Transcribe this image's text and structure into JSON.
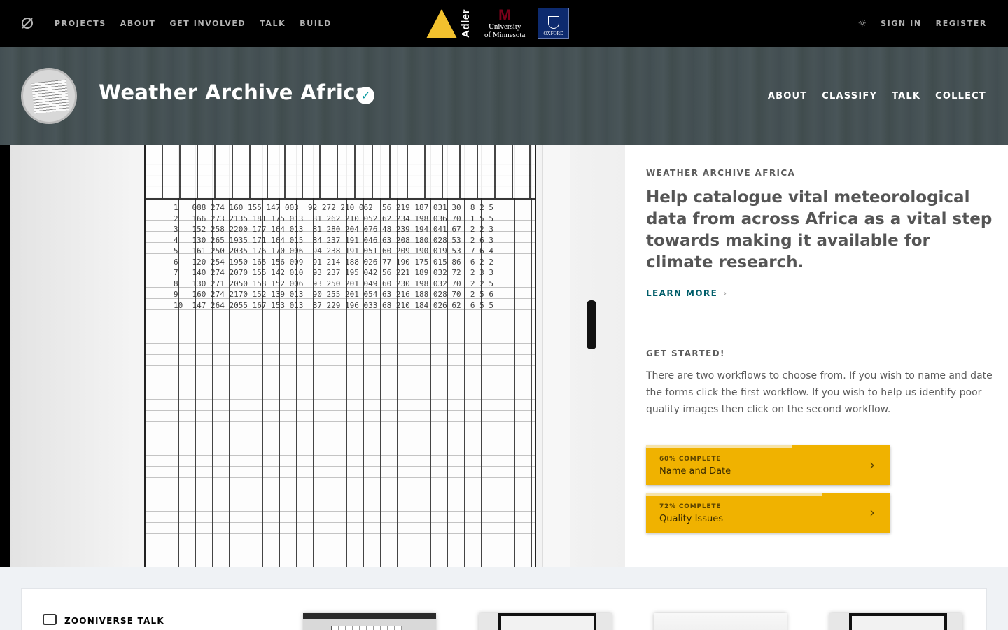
{
  "topnav": {
    "links": [
      "PROJECTS",
      "ABOUT",
      "GET INVOLVED",
      "TALK",
      "BUILD"
    ],
    "sign_in": "SIGN IN",
    "register": "REGISTER",
    "partners": {
      "adler": "Adler",
      "umn_line1": "University",
      "umn_line2": "of Minnesota",
      "oxford": "OXFORD"
    }
  },
  "project": {
    "title": "Weather Archive Africa",
    "nav": [
      "ABOUT",
      "CLASSIFY",
      "TALK",
      "COLLECT"
    ]
  },
  "hero": {
    "ledger_rows": "1   088 274 160 155 147 003  92 272 210 062  56 219 187 031 30  8 2 5\n2   166 273 2135 181 175 013  81 262 210 052 62 234 198 036 70  1 5 5\n3   152 258 2200 177 164 013  81 280 204 076 48 239 194 041 67  2 2 3\n4   130 265 1935 171 164 015  84 237 191 046 63 208 180 028 53  2 6 3\n5   161 250 2035 176 170 006  94 238 191 051 60 209 190 019 53  7 6 4\n6   120 254 1950 165 156 009  91 214 188 026 77 190 175 015 86  6 2 2\n7   140 274 2070 155 142 010  93 237 195 042 56 221 189 032 72  2 3 3\n8   130 271 2050 158 152 006  93 250 201 049 60 230 198 032 70  2 2 5\n9   160 274 2170 152 139 013  90 255 201 054 63 216 188 028 70  2 5 6\n10  147 264 2055 167 153 013  87 229 196 033 68 210 184 026 62  6 5 5"
  },
  "panel": {
    "kicker": "WEATHER ARCHIVE AFRICA",
    "description": "Help catalogue vital meteorological data from across Africa as a vital step towards making it available for climate research.",
    "learn_more": "LEARN MORE",
    "get_started": "GET STARTED!",
    "get_started_text": "There are two workflows to choose from. If you wish to name and date the forms click the first workflow. If you wish to help us identify poor quality images then click on the second workflow.",
    "workflows": [
      {
        "progress_label": "60% COMPLETE",
        "progress": 0.6,
        "name": "Name and Date"
      },
      {
        "progress_label": "72% COMPLETE",
        "progress": 0.72,
        "name": "Quality Issues"
      }
    ]
  },
  "talk": {
    "title": "ZOONIVERSE TALK"
  },
  "colors": {
    "workflow_button": "#f0b200",
    "learn_more": "#005d69",
    "verified": "#00979d"
  }
}
